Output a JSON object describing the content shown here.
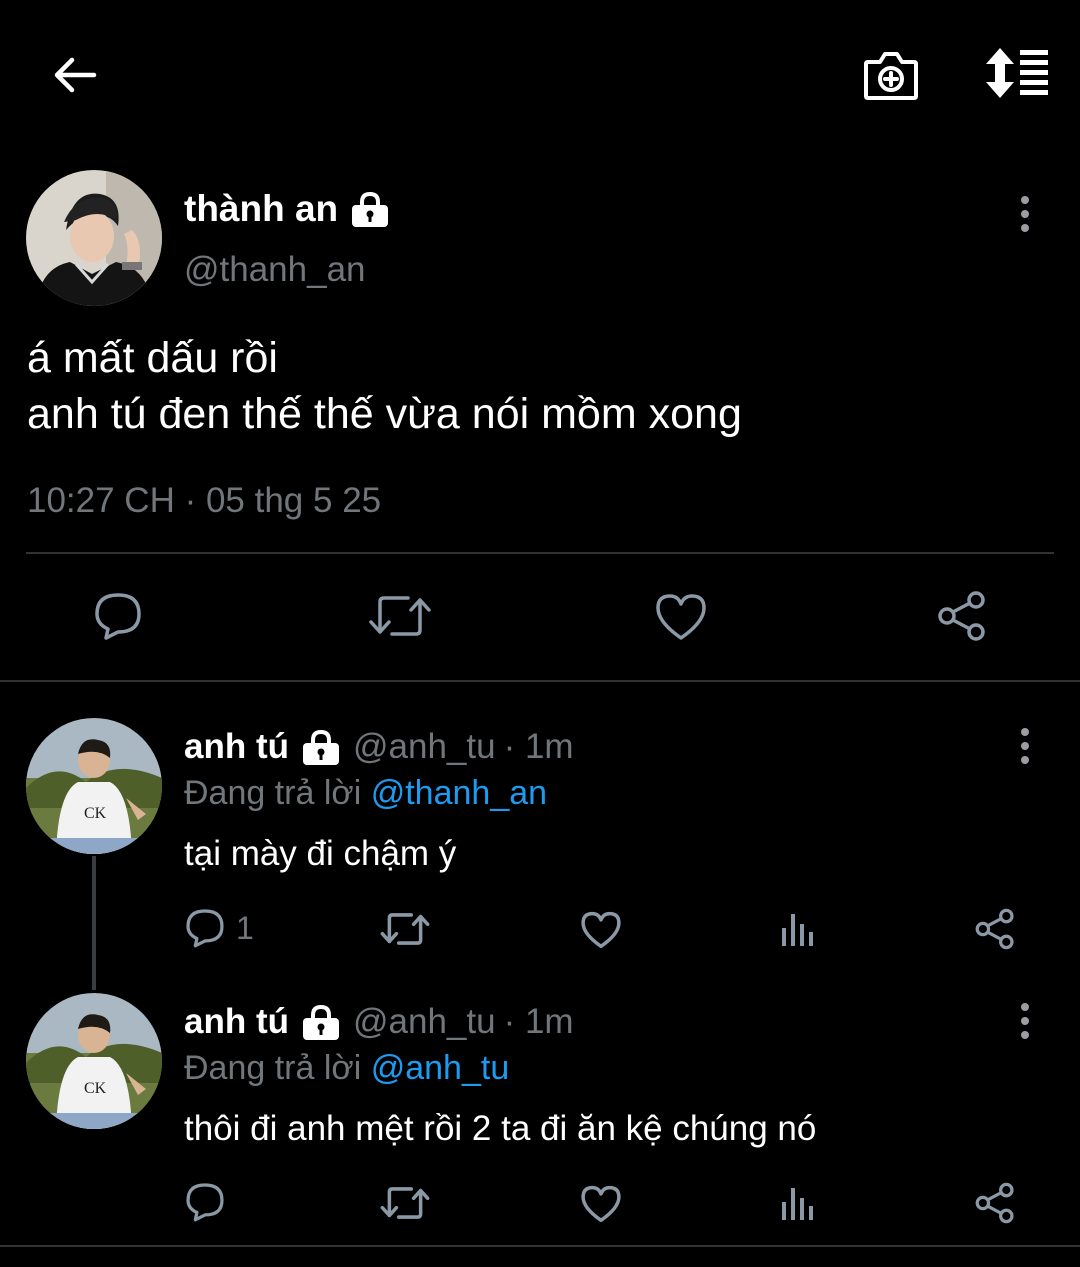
{
  "colors": {
    "background": "#000000",
    "text": "#e7e9ea",
    "muted": "#71767b",
    "link": "#1d9bf0",
    "divider": "#2f3336"
  },
  "top_bar": {
    "back_icon": "arrow-left-icon",
    "camera_icon": "camera-add-icon",
    "sort_icon": "sort-list-icon"
  },
  "main_tweet": {
    "display_name": "thành an",
    "handle": "@thanh_an",
    "lock_icon": "lock-icon",
    "text_line1": "á mất dấu rồi",
    "text_line2": "anh tú đen thế thế vừa nói mồm xong",
    "timestamp": "10:27 CH · 05 thg 5 25",
    "actions": [
      "reply-icon",
      "retweet-icon",
      "like-icon",
      "share-icon"
    ]
  },
  "replies": [
    {
      "display_name": "anh tú",
      "handle": "@anh_tu",
      "time": "· 1m",
      "replying_prefix": "Đang trả lời",
      "replying_to": "@thanh_an",
      "text": "tại mày đi chậm ý",
      "reply_count": "1"
    },
    {
      "display_name": "anh tú",
      "handle": "@anh_tu",
      "time": "· 1m",
      "replying_prefix": "Đang trả lời",
      "replying_to": "@anh_tu",
      "text": "thôi đi anh mệt rồi 2 ta đi ăn kệ chúng nó",
      "reply_count": ""
    }
  ]
}
